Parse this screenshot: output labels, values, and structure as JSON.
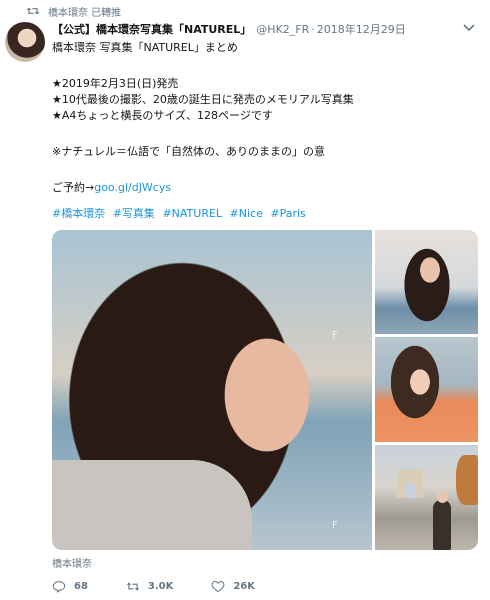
{
  "retweet": {
    "text": "橋本環奈 已轉推",
    "icon": "retweet-icon"
  },
  "tweet": {
    "author_name": "【公式】橋本環奈写真集「NATUREL」",
    "handle": "@HK2_FR",
    "separator": "·",
    "date": "2018年12月29日",
    "lines": {
      "l1": "橋本環奈 写真集「NATUREL」まとめ",
      "l2": "★2019年2月3日(日)発売",
      "l3": "★10代最後の撮影、20歳の誕生日に発売のメモリアル写真集",
      "l4": "★A4ちょっと横長のサイズ、128ページです",
      "l5": "※ナチュレル＝仏語で「自然体の、ありのままの」の意",
      "l6_prefix": "ご予約→",
      "l6_link": "goo.gl/dJWcys"
    },
    "hashtags": [
      "#橋本環奈",
      "#写真集",
      "#NATUREL",
      "#Nice",
      "#Paris"
    ],
    "media_watermark": "F",
    "media_caption": "橋本環奈"
  },
  "actions": {
    "reply_count": "68",
    "retweet_count": "3.0K",
    "like_count": "26K"
  },
  "colors": {
    "link": "#1b95e0",
    "muted": "#657786",
    "text": "#14171a"
  }
}
